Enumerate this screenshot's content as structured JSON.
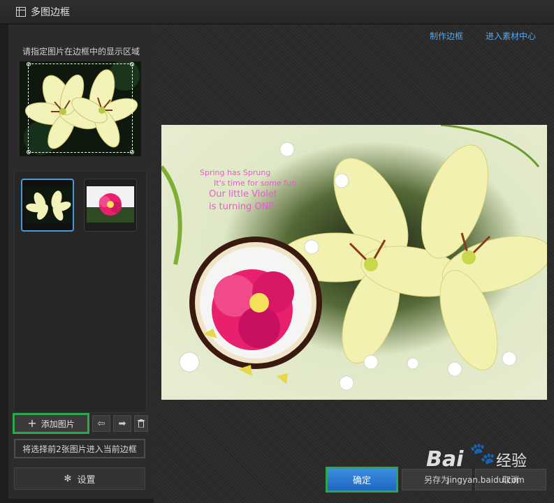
{
  "window": {
    "title": "多图边框"
  },
  "left": {
    "preview_label": "请指定图片在边框中的显示区域",
    "add_button": "添加图片",
    "apply_button": "将选择前2张图片进入当前边框",
    "settings_button": "设置"
  },
  "right": {
    "link_make": "制作边框",
    "link_market": "进入素材中心",
    "ok_button": "确定",
    "save_button": "另存为",
    "cancel_button": "取消"
  },
  "frame_text": {
    "line1": "Spring has Sprung",
    "line2": "It's time for some fun",
    "line3": "Our little Violet",
    "line4": "is turning ONE !"
  },
  "watermark": {
    "brand": "Bai",
    "brand2": "经验",
    "url": "jingyan.baidu.com"
  },
  "colors": {
    "accent_green": "#2ca84a",
    "link_blue": "#5aa7e8",
    "ok_blue": "#2b78d2"
  }
}
